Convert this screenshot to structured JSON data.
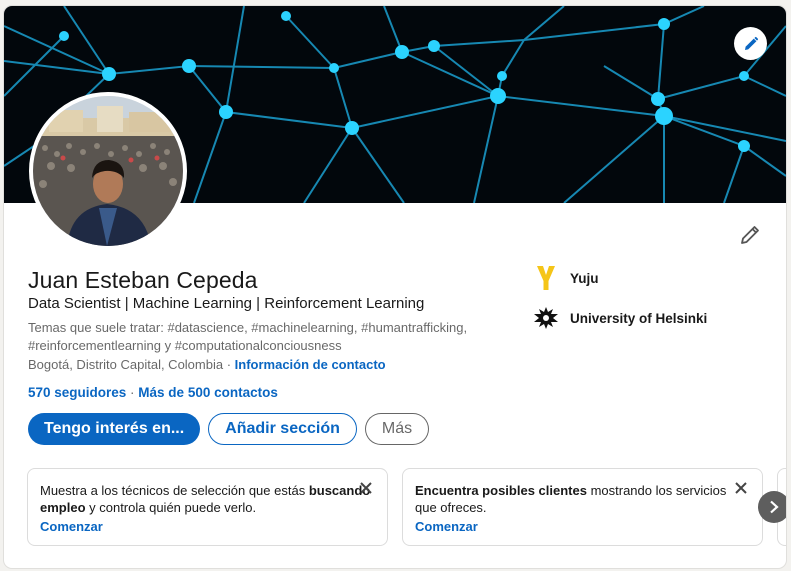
{
  "profile": {
    "name": "Juan Esteban Cepeda",
    "headline": "Data Scientist | Machine Learning | Reinforcement Learning",
    "topics": "Temas que suele tratar: #datascience, #machinelearning, #humantrafficking, #reinforcementlearning y #computationalconciousness",
    "location": "Bogotá, Distrito Capital, Colombia",
    "location_sep": " · ",
    "contact_info": "Información de contacto",
    "followers": "570 seguidores",
    "network_sep": " · ",
    "connections": "Más de 500 contactos"
  },
  "actions": {
    "open_to": "Tengo interés en...",
    "add_section": "Añadir sección",
    "more": "Más"
  },
  "organizations": [
    {
      "name": "Yuju",
      "logo": "yuju-logo",
      "logo_color": "#f5c518"
    },
    {
      "name": "University of Helsinki",
      "logo": "university-helsinki-logo",
      "logo_color": "#111111"
    }
  ],
  "suggestions": [
    {
      "text_a": "Muestra a los técnicos de selección que estás ",
      "text_b": "buscando empleo",
      "text_c": " y controla quién puede verlo.",
      "cta": "Comenzar"
    },
    {
      "text_a": "Encuentra posibles clientes",
      "text_b": " mostrando los servicios que ofreces.",
      "cta": "Comenzar"
    }
  ],
  "icons": {
    "banner_edit": "pencil-icon",
    "intro_edit": "pencil-icon",
    "dismiss": "close-icon",
    "next": "chevron-right-icon"
  },
  "colors": {
    "accent": "#0a66c2",
    "banner_bg": "#02070c",
    "network_line": "#1aa7d8",
    "network_node": "#2bd6ff"
  }
}
